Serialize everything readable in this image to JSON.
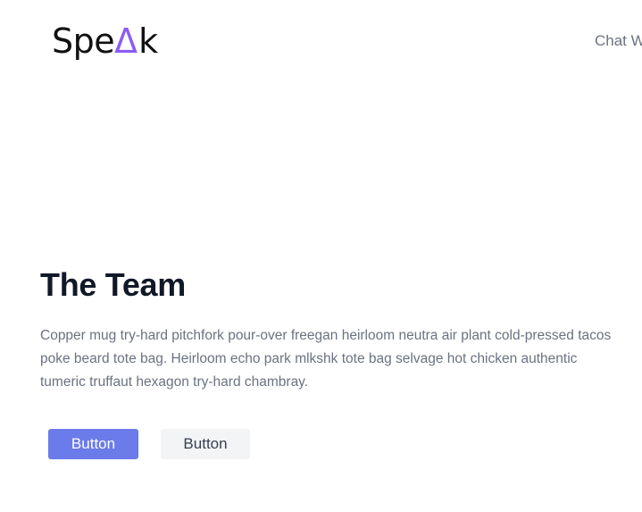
{
  "header": {
    "logo": {
      "prefix": "Spe",
      "mark": "Δ",
      "suffix": "k"
    },
    "nav_item": "Chat W"
  },
  "hero": {
    "title": "The Team",
    "description": "Copper mug try-hard pitchfork pour-over freegan heirloom neutra air plant cold-pressed tacos poke beard tote bag. Heirloom echo park mlkshk tote bag selvage hot chicken authentic tumeric truffaut hexagon try-hard chambray.",
    "primary_button": "Button",
    "secondary_button": "Button"
  },
  "colors": {
    "accent": "#6b7bea",
    "logo_mark": "#8b5cf6",
    "title": "#111827",
    "body_text": "#6b7280"
  }
}
